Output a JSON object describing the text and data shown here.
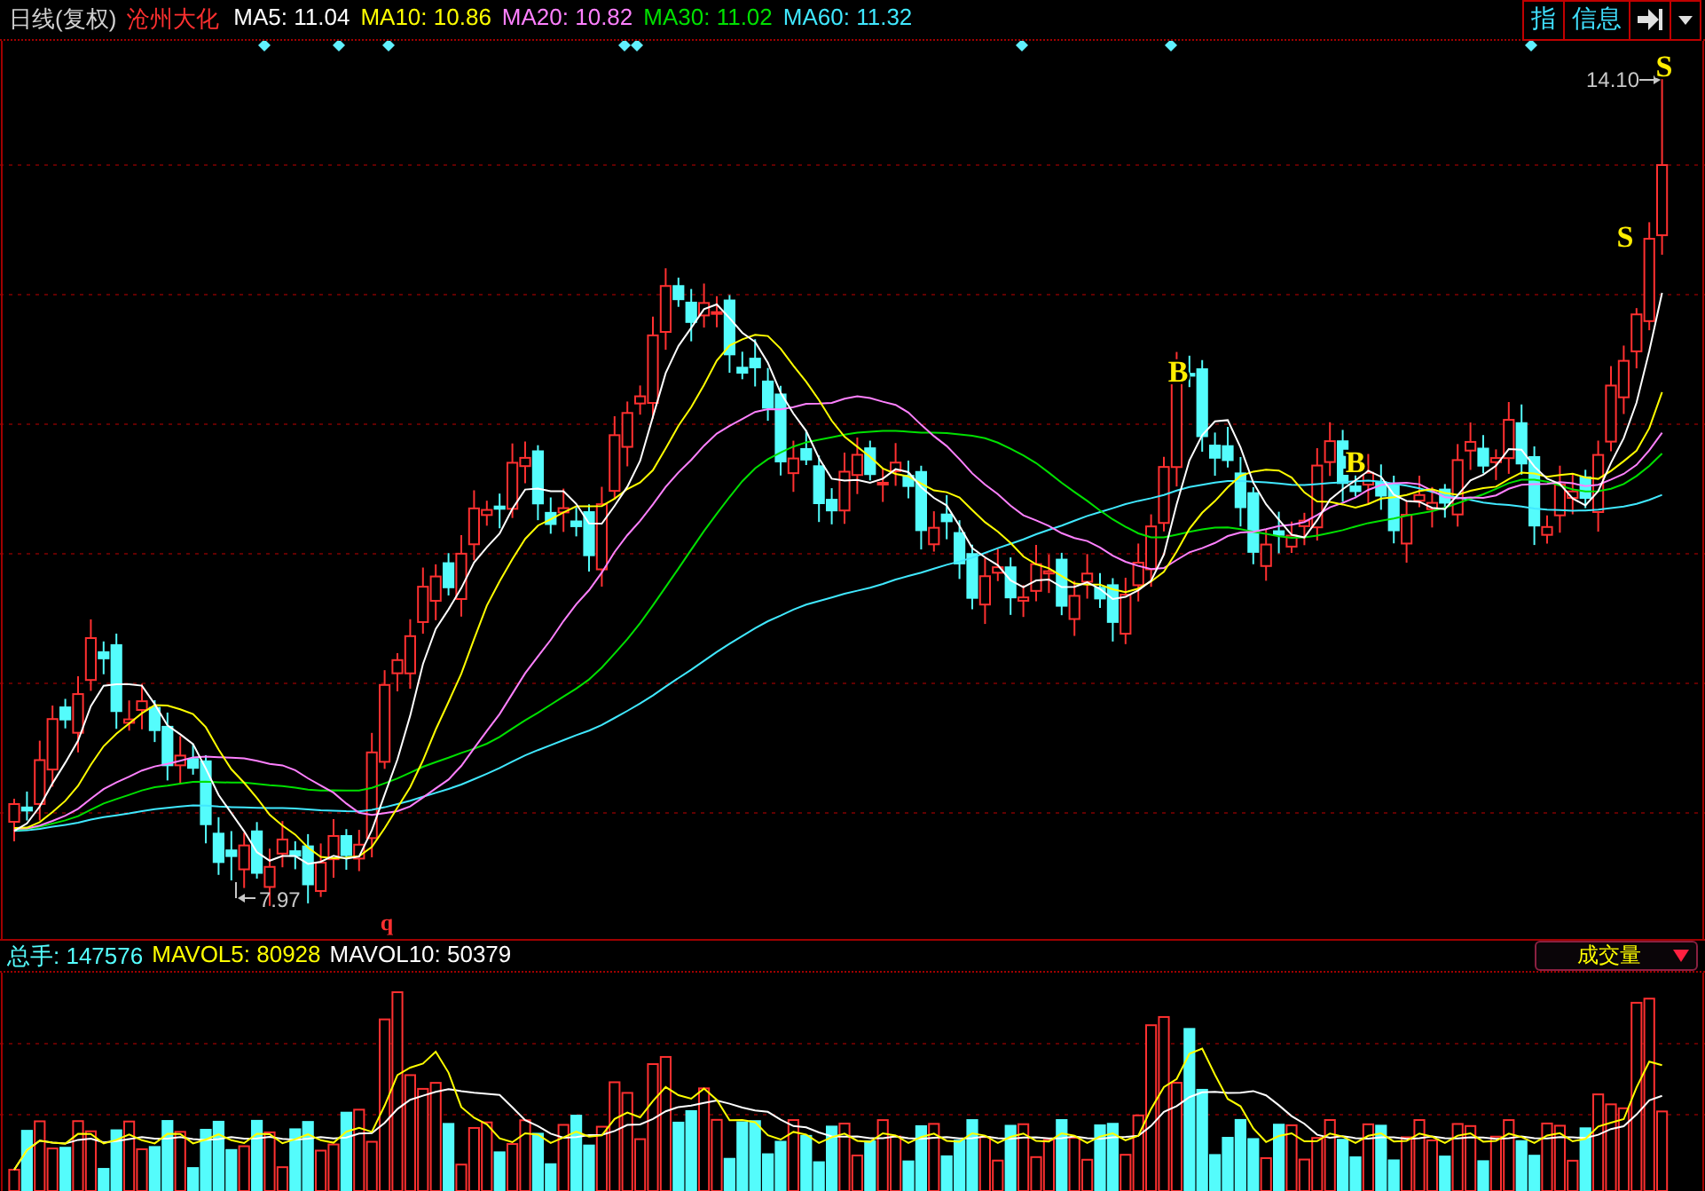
{
  "header": {
    "period": "日线(复权)",
    "stock_name": "沧州大化",
    "ma_legend": [
      {
        "label": "MA5: 11.04",
        "color": "#ffffff"
      },
      {
        "label": "MA10: 10.86",
        "color": "#ffff00"
      },
      {
        "label": "MA20: 10.82",
        "color": "#ff80ff"
      },
      {
        "label": "MA30: 11.02",
        "color": "#00e000"
      },
      {
        "label": "MA60: 11.32",
        "color": "#40e8ff"
      }
    ]
  },
  "toolbar": [
    {
      "kind": "text",
      "label": "指"
    },
    {
      "kind": "text",
      "label": "信息"
    },
    {
      "kind": "arrow"
    },
    {
      "kind": "caret"
    }
  ],
  "price_chart": {
    "high_label": "14.10",
    "low_label": "7.97",
    "marker": "q",
    "signals": [
      {
        "label": "S"
      },
      {
        "label": "S"
      },
      {
        "label": "B"
      },
      {
        "label": "B"
      }
    ]
  },
  "volume_panel": {
    "legend": [
      {
        "label": "总手: 147576",
        "color": "#55ffff"
      },
      {
        "label": "MAVOL5: 80928",
        "color": "#ffff00"
      },
      {
        "label": "MAVOL10: 50379",
        "color": "#ffffff"
      }
    ],
    "indicator_select": {
      "value": "成交量"
    }
  }
}
